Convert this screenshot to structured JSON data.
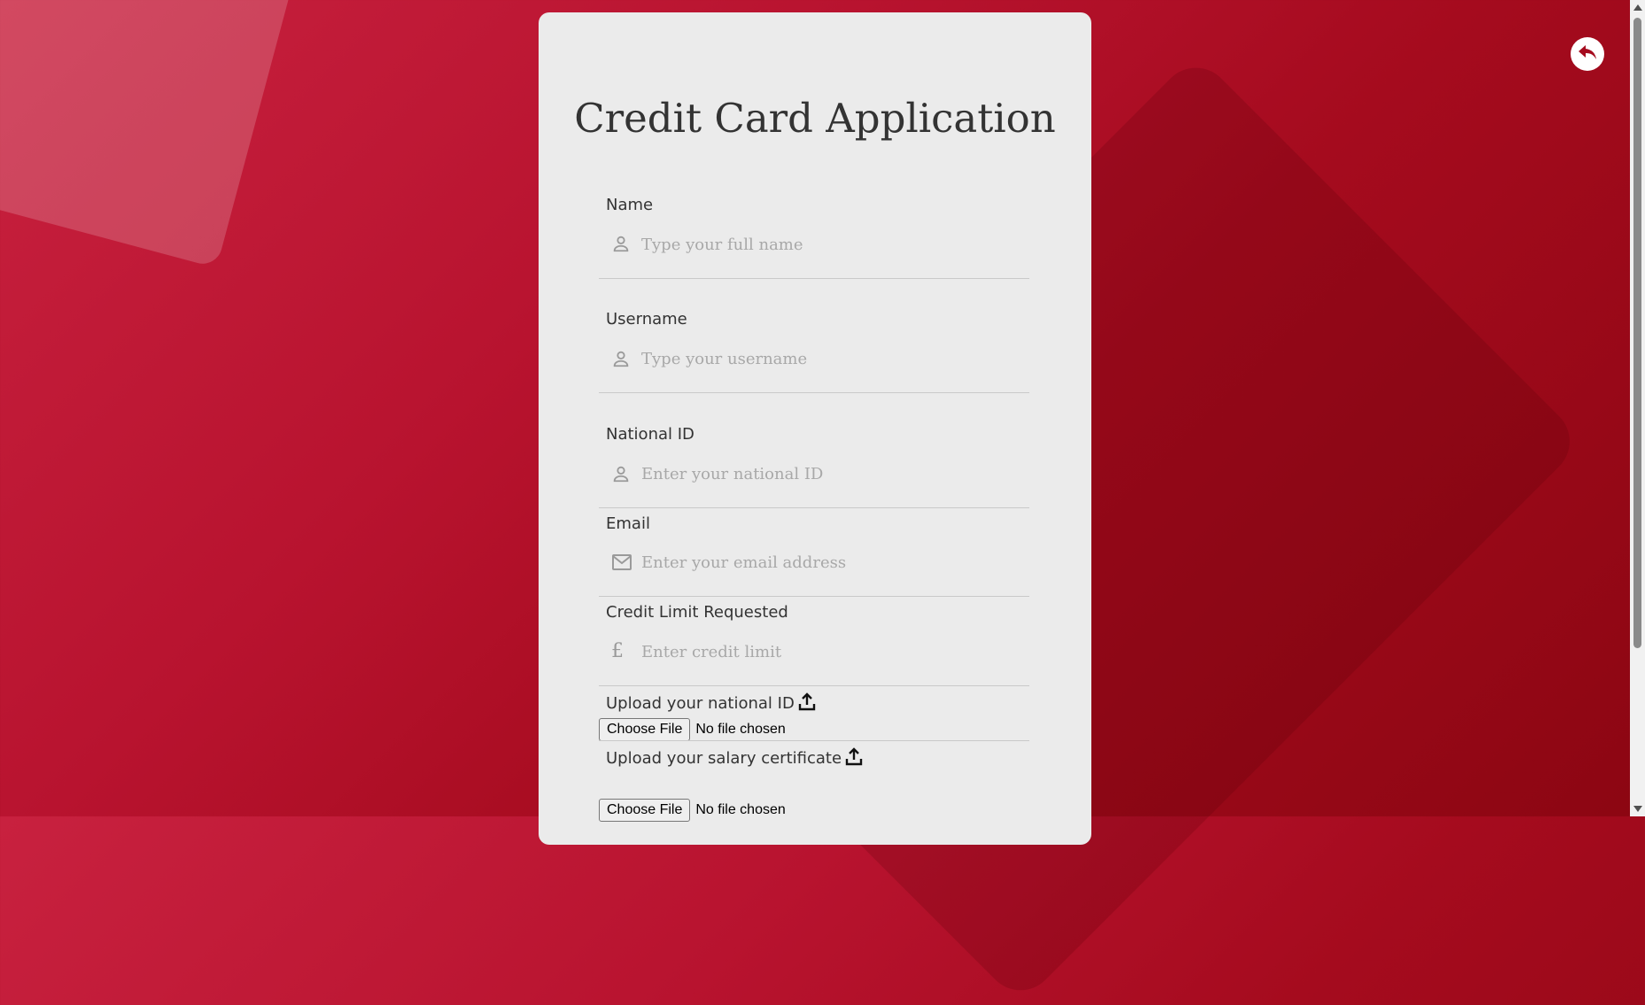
{
  "form": {
    "title": "Credit Card Application",
    "fields": [
      {
        "label": "Name",
        "placeholder": "Type your full name",
        "icon": "user-icon"
      },
      {
        "label": "Username",
        "placeholder": "Type your username",
        "icon": "user-icon"
      },
      {
        "label": "National ID",
        "placeholder": "Enter your national ID",
        "icon": "user-icon"
      },
      {
        "label": "Email",
        "placeholder": "Enter your email address",
        "icon": "mail-icon"
      },
      {
        "label": "Credit Limit Requested",
        "placeholder": "Enter credit limit",
        "icon": "pound-icon"
      }
    ],
    "uploads": [
      {
        "label": "Upload your national ID",
        "button": "Choose File",
        "status": "No file chosen",
        "icon": "upload-icon"
      },
      {
        "label": "Upload your salary certificate",
        "button": "Choose File",
        "status": "No file chosen",
        "icon": "upload-icon"
      }
    ],
    "pound_symbol": "£"
  },
  "back_button": {
    "icon": "reply-arrow-icon"
  },
  "colors": {
    "background_start": "#c8213f",
    "background_end": "#8c0612",
    "card": "#ebebeb",
    "accent": "#a50b1e"
  }
}
